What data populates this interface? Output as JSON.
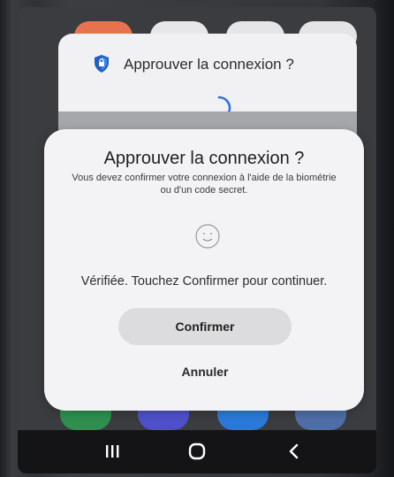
{
  "background_notification": {
    "title": "Approuver la connexion ?"
  },
  "dialog": {
    "title": "Approuver la connexion ?",
    "subtitle": "Vous devez confirmer votre connexion à l'aide de la biométrie ou d'un code secret.",
    "status": "Vérifiée. Touchez Confirmer pour continuer.",
    "confirm_label": "Confirmer",
    "cancel_label": "Annuler"
  },
  "colors": {
    "dialog_bg": "#f3f3f5",
    "confirm_bg": "#dcdcde",
    "accent_spinner": "#2f6fe0",
    "authenticator_shield": "#1f5fbf"
  },
  "icons": {
    "app_icon": "authenticator-shield-icon",
    "loading": "spinner-icon",
    "biometric": "face-recognition-icon",
    "nav_recent": "recent-apps-icon",
    "nav_home": "home-icon",
    "nav_back": "back-icon"
  }
}
